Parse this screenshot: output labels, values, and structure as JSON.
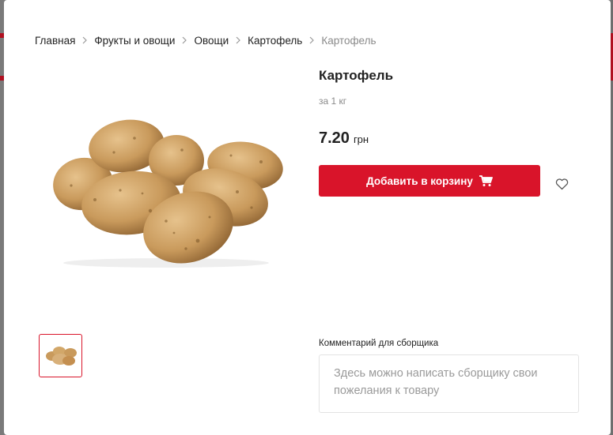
{
  "breadcrumb": {
    "items": [
      "Главная",
      "Фрукты и овощи",
      "Овощи",
      "Картофель"
    ],
    "current": "Картофель"
  },
  "product": {
    "title": "Картофель",
    "unit": "за 1 кг",
    "price": "7.20",
    "currency": "грн",
    "image_icon": "potatoes-image"
  },
  "actions": {
    "add_to_cart": "Добавить в корзину",
    "cart_icon": "cart-icon",
    "favorite_icon": "heart-icon"
  },
  "comment": {
    "label": "Комментарий для сборщика",
    "placeholder": "Здесь можно написать сборщику свои пожелания к товару",
    "value": ""
  },
  "colors": {
    "accent": "#d9142a",
    "text": "#222222",
    "muted": "#8a8a8a"
  }
}
